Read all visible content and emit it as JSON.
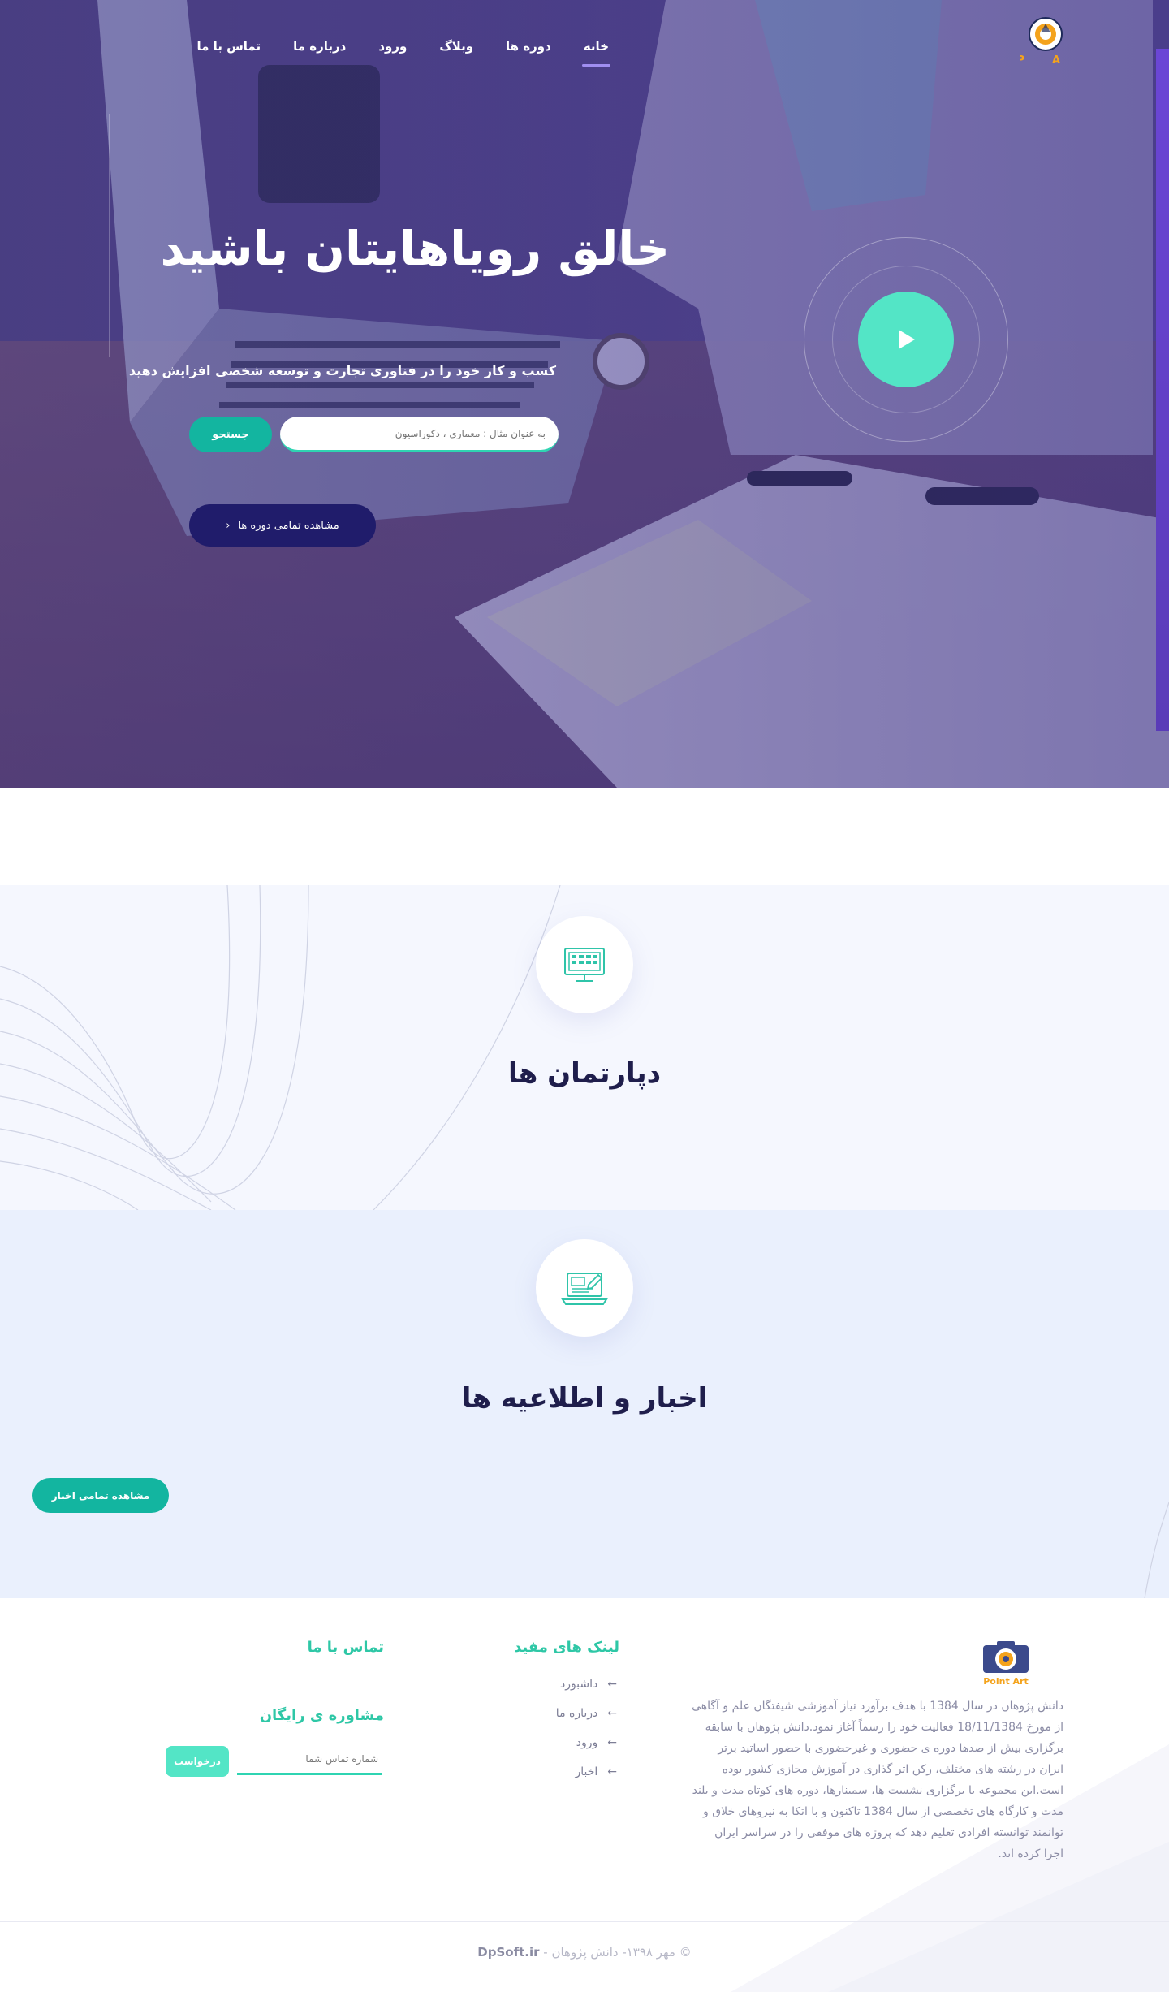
{
  "nav": {
    "items": [
      "خانه",
      "دوره ها",
      "وبلاگ",
      "ورود",
      "درباره ما",
      "تماس با ما"
    ],
    "active_index": 0,
    "logo_letters": [
      "P",
      "A"
    ]
  },
  "hero": {
    "title": "خالق رویاهایتان باشید",
    "subtitle": "کسب و کار خود را در فناوری تجارت و توسعه شخصی افزایش دهید",
    "search_placeholder": "به عنوان مثال : معماری ، دکوراسیون",
    "search_button": "جستجو",
    "all_courses_button": "مشاهده تمامی دوره ها",
    "all_courses_arrow": "‹"
  },
  "departments": {
    "title": "دپارتمان ها",
    "icon": "monitor-icon"
  },
  "news": {
    "title": "اخبار و اطلاعیه ها",
    "icon": "laptop-edit-icon",
    "all_news_button": "مشاهده تمامی اخبار"
  },
  "footer": {
    "logo_text": "Point Art",
    "about": "دانش پژوهان در سال 1384 با هدف برآورد نیاز آموزشی شیفتگان علم و آگاهی از مورخ 18/11/1384 فعالیت خود را رسماً آغاز نمود.دانش پژوهان با سابقه برگزاری بیش از صدها دوره ی حضوری و غیرحضوری با حضور اساتید برتر ایران در رشته های مختلف، رکن اثر گذاری در آموزش مجازی کشور بوده است.این مجموعه با برگزاری نشست ها، سمینارها، دوره های کوتاه مدت و بلند مدت و کارگاه های تخصصی از سال 1384 تاکنون و با اتکا به نیروهای خلاق و توانمند توانسته افرادی تعلیم دهد که پروژه های موفقی را در سراسر ایران اجرا کرده اند.",
    "useful_links_title": "لینک های مفید",
    "useful_links": [
      "داشبورد",
      "درباره ما",
      "ورود",
      "اخبار"
    ],
    "link_arrow": "←",
    "contact_title": "تماس با ما",
    "consult_title": "مشاوره ی رایگان",
    "consult_placeholder": "شماره تماس شما",
    "consult_button": "درخواست",
    "copyright_prefix": "© مهر ۱۳۹۸- دانش پژوهان - ",
    "copyright_brand": "DpSoft.ir"
  },
  "colors": {
    "accent": "#13b5a0",
    "accent_light": "#53e5c6",
    "navy": "#201c6b",
    "heading": "#1f1e4c",
    "nav_underline": "#a08ef0"
  }
}
